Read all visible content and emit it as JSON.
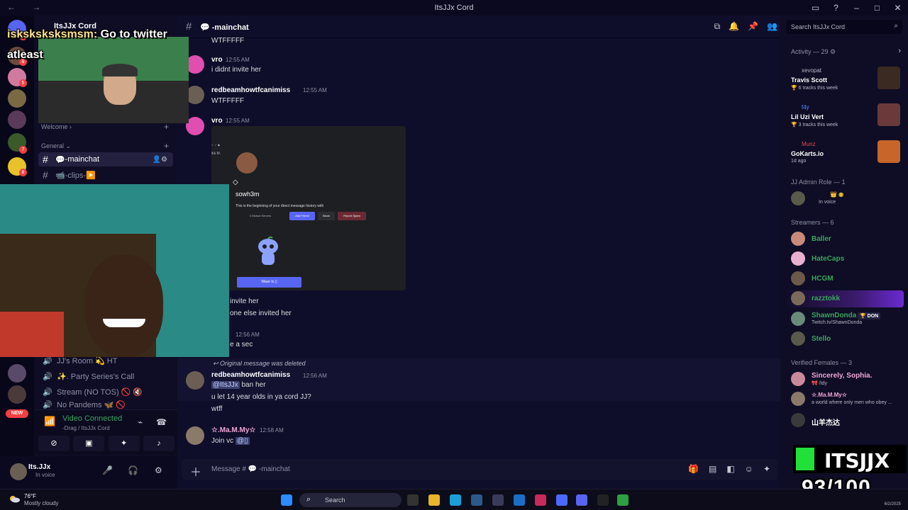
{
  "window": {
    "title": "ItsJJx Cord"
  },
  "server": {
    "name": "ItsJJx Cord"
  },
  "server_badges": [
    "22",
    "8",
    "5",
    "7",
    "8"
  ],
  "server_new_pill": "NEW",
  "sidebar": {
    "categories": [
      {
        "label": "Welcome ›"
      },
      {
        "label": "General ⌄"
      }
    ],
    "text_channels": [
      {
        "emoji": "💬",
        "label": "-mainchat",
        "active": true
      },
      {
        "emoji": "📹",
        "label": "-clips-▶️"
      }
    ],
    "voice_channels": [
      {
        "label": "JJ's Room 💫 HT"
      },
      {
        "label": "✨. Party Series's Call"
      },
      {
        "label": "Stream (NO TOS) 🚫 🔇"
      },
      {
        "label": "No Pandems 🦋 🚫"
      }
    ]
  },
  "voice": {
    "status": "Video Connected",
    "location": "-Drag / ItsJJx Cord"
  },
  "user": {
    "name": "Its.JJx",
    "status": "In voice"
  },
  "chat": {
    "channel_emoji": "💬",
    "channel_name": "-mainchat",
    "messages": [
      {
        "text": "WTFFFFF"
      },
      {
        "author": "vro",
        "time": "12:55 AM",
        "text": "i didnt invite her"
      },
      {
        "author": "redbeamhowtfcanimiss",
        "time": "12:55 AM",
        "text": "WTFFFFF"
      },
      {
        "author": "vro",
        "time": "12:55 AM"
      },
      {
        "text": "invite her"
      },
      {
        "text": "one else invited her"
      },
      {
        "time": "12:56 AM",
        "text": "e a sec"
      },
      {
        "reply_indicator": "Original message was deleted",
        "author": "redbeamhowtfcanimiss",
        "time": "12:56 AM",
        "mention": "@ItsJJx",
        "text": "ban her",
        "line2": "u let 14 year olds in ya cord JJ?",
        "line3": "wtff"
      },
      {
        "author": "☆.Ma.M.My☆",
        "time": "12:58 AM",
        "text": "Join vc",
        "mention": "@▯"
      }
    ],
    "embed": {
      "partial_lines": [
        "✓ ✓ ◆",
        "ikk M."
      ],
      "name": "sowh3m",
      "desc": "This is the beginning of your direct message history with",
      "mutual": "4 Mutual Servers",
      "add_friend": "Add Friend",
      "block": "Block",
      "report": "Report Spam",
      "wave": "Wave to ▯"
    },
    "composer_placeholder": "Message # 💬 -mainchat"
  },
  "search": {
    "placeholder": "Search ItsJJx Cord"
  },
  "members": {
    "activity_header": "Activity — 29 ⚙",
    "activities": [
      {
        "user": "xevopat",
        "title": "Travis Scott",
        "sub": "🏆 6 tracks this week",
        "user_color": "#b5b8c8",
        "art": "#3a2a22"
      },
      {
        "user": "f4y",
        "title": "Lil Uzi Vert",
        "sub": "🏆 3 tracks this week",
        "user_color": "#5b8cff",
        "art": "#6a3a3a"
      },
      {
        "user": "Munz",
        "title": "GoKarts.io",
        "sub": "1d ago",
        "user_color": "#e24b4b",
        "art": "#c7652b"
      }
    ],
    "admin_header": "JJ Admin Role — 1",
    "admin": {
      "badges": "👑 ◉",
      "status": "In voice"
    },
    "streamers_header": "Streamers — 6",
    "streamers": [
      {
        "name": "Baller",
        "color": "#3ba55d"
      },
      {
        "name": "HateCaps",
        "color": "#3ba55d"
      },
      {
        "name": "HCGM",
        "color": "#3ba55d"
      },
      {
        "name": "razztokk",
        "color": "#3ba55d"
      },
      {
        "name": "ShawnDonda",
        "color": "#3ba55d",
        "tag": "🏆 DON",
        "sub": "Twitch.tv/ShawnDonda"
      },
      {
        "name": "Stello",
        "color": "#3ba55d"
      }
    ],
    "females_header": "Verified Females — 3",
    "females": [
      {
        "name": "Sincerely, Sophia.",
        "color": "#f0a6d6",
        "sub": "🎀 /tdy"
      },
      {
        "name": "☆.Ma.M.My☆",
        "color": "#f0a6d6",
        "sub": "a world where only men who obey ..."
      },
      {
        "name": "山羊杰达",
        "color": "#ffffff"
      }
    ]
  },
  "overlay": {
    "chat_user": "isksksksksmsm:",
    "chat_text": "Go to twitter atleast",
    "logo_text": "ITSJJX",
    "counter": "93/100"
  },
  "taskbar": {
    "temperature": "76°F",
    "condition": "Mostly cloudy",
    "search_label": "Search",
    "date": "6/2/2025"
  },
  "colors": {
    "accent": "#5865f2",
    "online": "#3ba55d",
    "danger": "#f23f43"
  }
}
